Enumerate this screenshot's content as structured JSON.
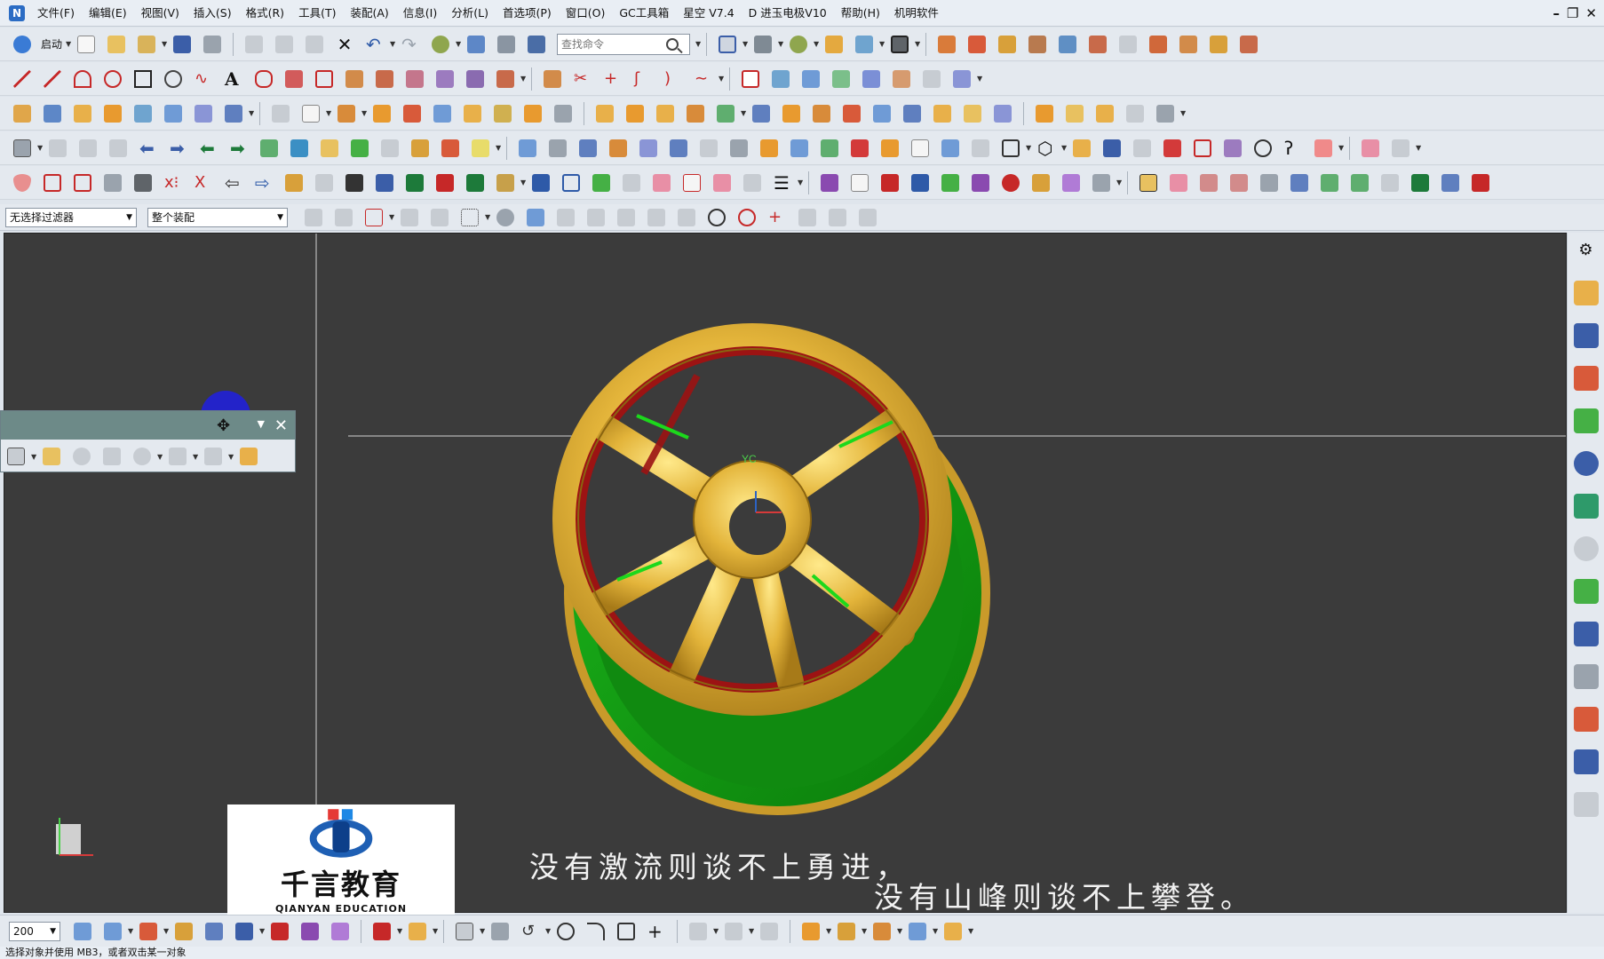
{
  "menubar": {
    "items": [
      "文件(F)",
      "编辑(E)",
      "视图(V)",
      "插入(S)",
      "格式(R)",
      "工具(T)",
      "装配(A)",
      "信息(I)",
      "分析(L)",
      "首选项(P)",
      "窗口(O)",
      "GC工具箱",
      "星空 V7.4",
      "D 进玉电极V10",
      "帮助(H)",
      "机明软件"
    ],
    "controls": [
      "–",
      "❐",
      "✕"
    ]
  },
  "toolbar": {
    "start_label": "启动",
    "search_placeholder": "查找命令"
  },
  "selection": {
    "filter": "无选择过滤器",
    "scope": "整个装配"
  },
  "viewport": {
    "axis_label": "YC"
  },
  "bottom": {
    "zoom": "200"
  },
  "status": {
    "text": "选择对象并使用 MB3，或者双击某一对象"
  },
  "logo": {
    "cn": "千言教育",
    "en": "QIANYAN EDUCATION"
  },
  "subtitles": {
    "line1": "没有激流则谈不上勇进，",
    "line2": "没有山峰则谈不上攀登。"
  },
  "colors": {
    "viewport_bg": "#3b3b3b",
    "rim_gold": "#e3b43a",
    "rim_red": "#9c1313",
    "rim_green": "#12a312"
  }
}
